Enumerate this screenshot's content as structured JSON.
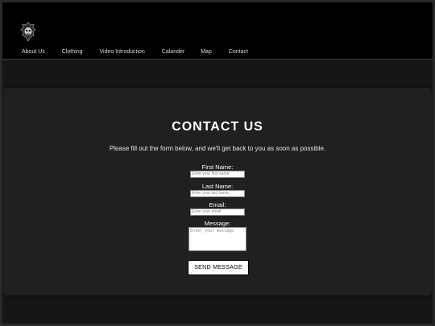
{
  "nav": {
    "items": [
      "About Us",
      "Clothing",
      "Video Introduction",
      "Calander",
      "Map",
      "Contact"
    ]
  },
  "logo": {
    "icon": "skull-emblem-icon"
  },
  "contact": {
    "title": "CONTACT US",
    "subtitle": "Please fill out the form below, and we'll get back to you as soon as possible.",
    "first_name_label": "First Name:",
    "first_name_placeholder": "Enter your first name",
    "last_name_label": "Last Name:",
    "last_name_placeholder": "Enter your last name",
    "email_label": "Email:",
    "email_placeholder": "Enter your email",
    "message_label": "Message:",
    "message_placeholder": "Enter your message",
    "submit_label": "SEND MESSAGE"
  },
  "colors": {
    "background": "#161616",
    "header": "#000000",
    "card": "#202020",
    "text": "#ffffff"
  }
}
